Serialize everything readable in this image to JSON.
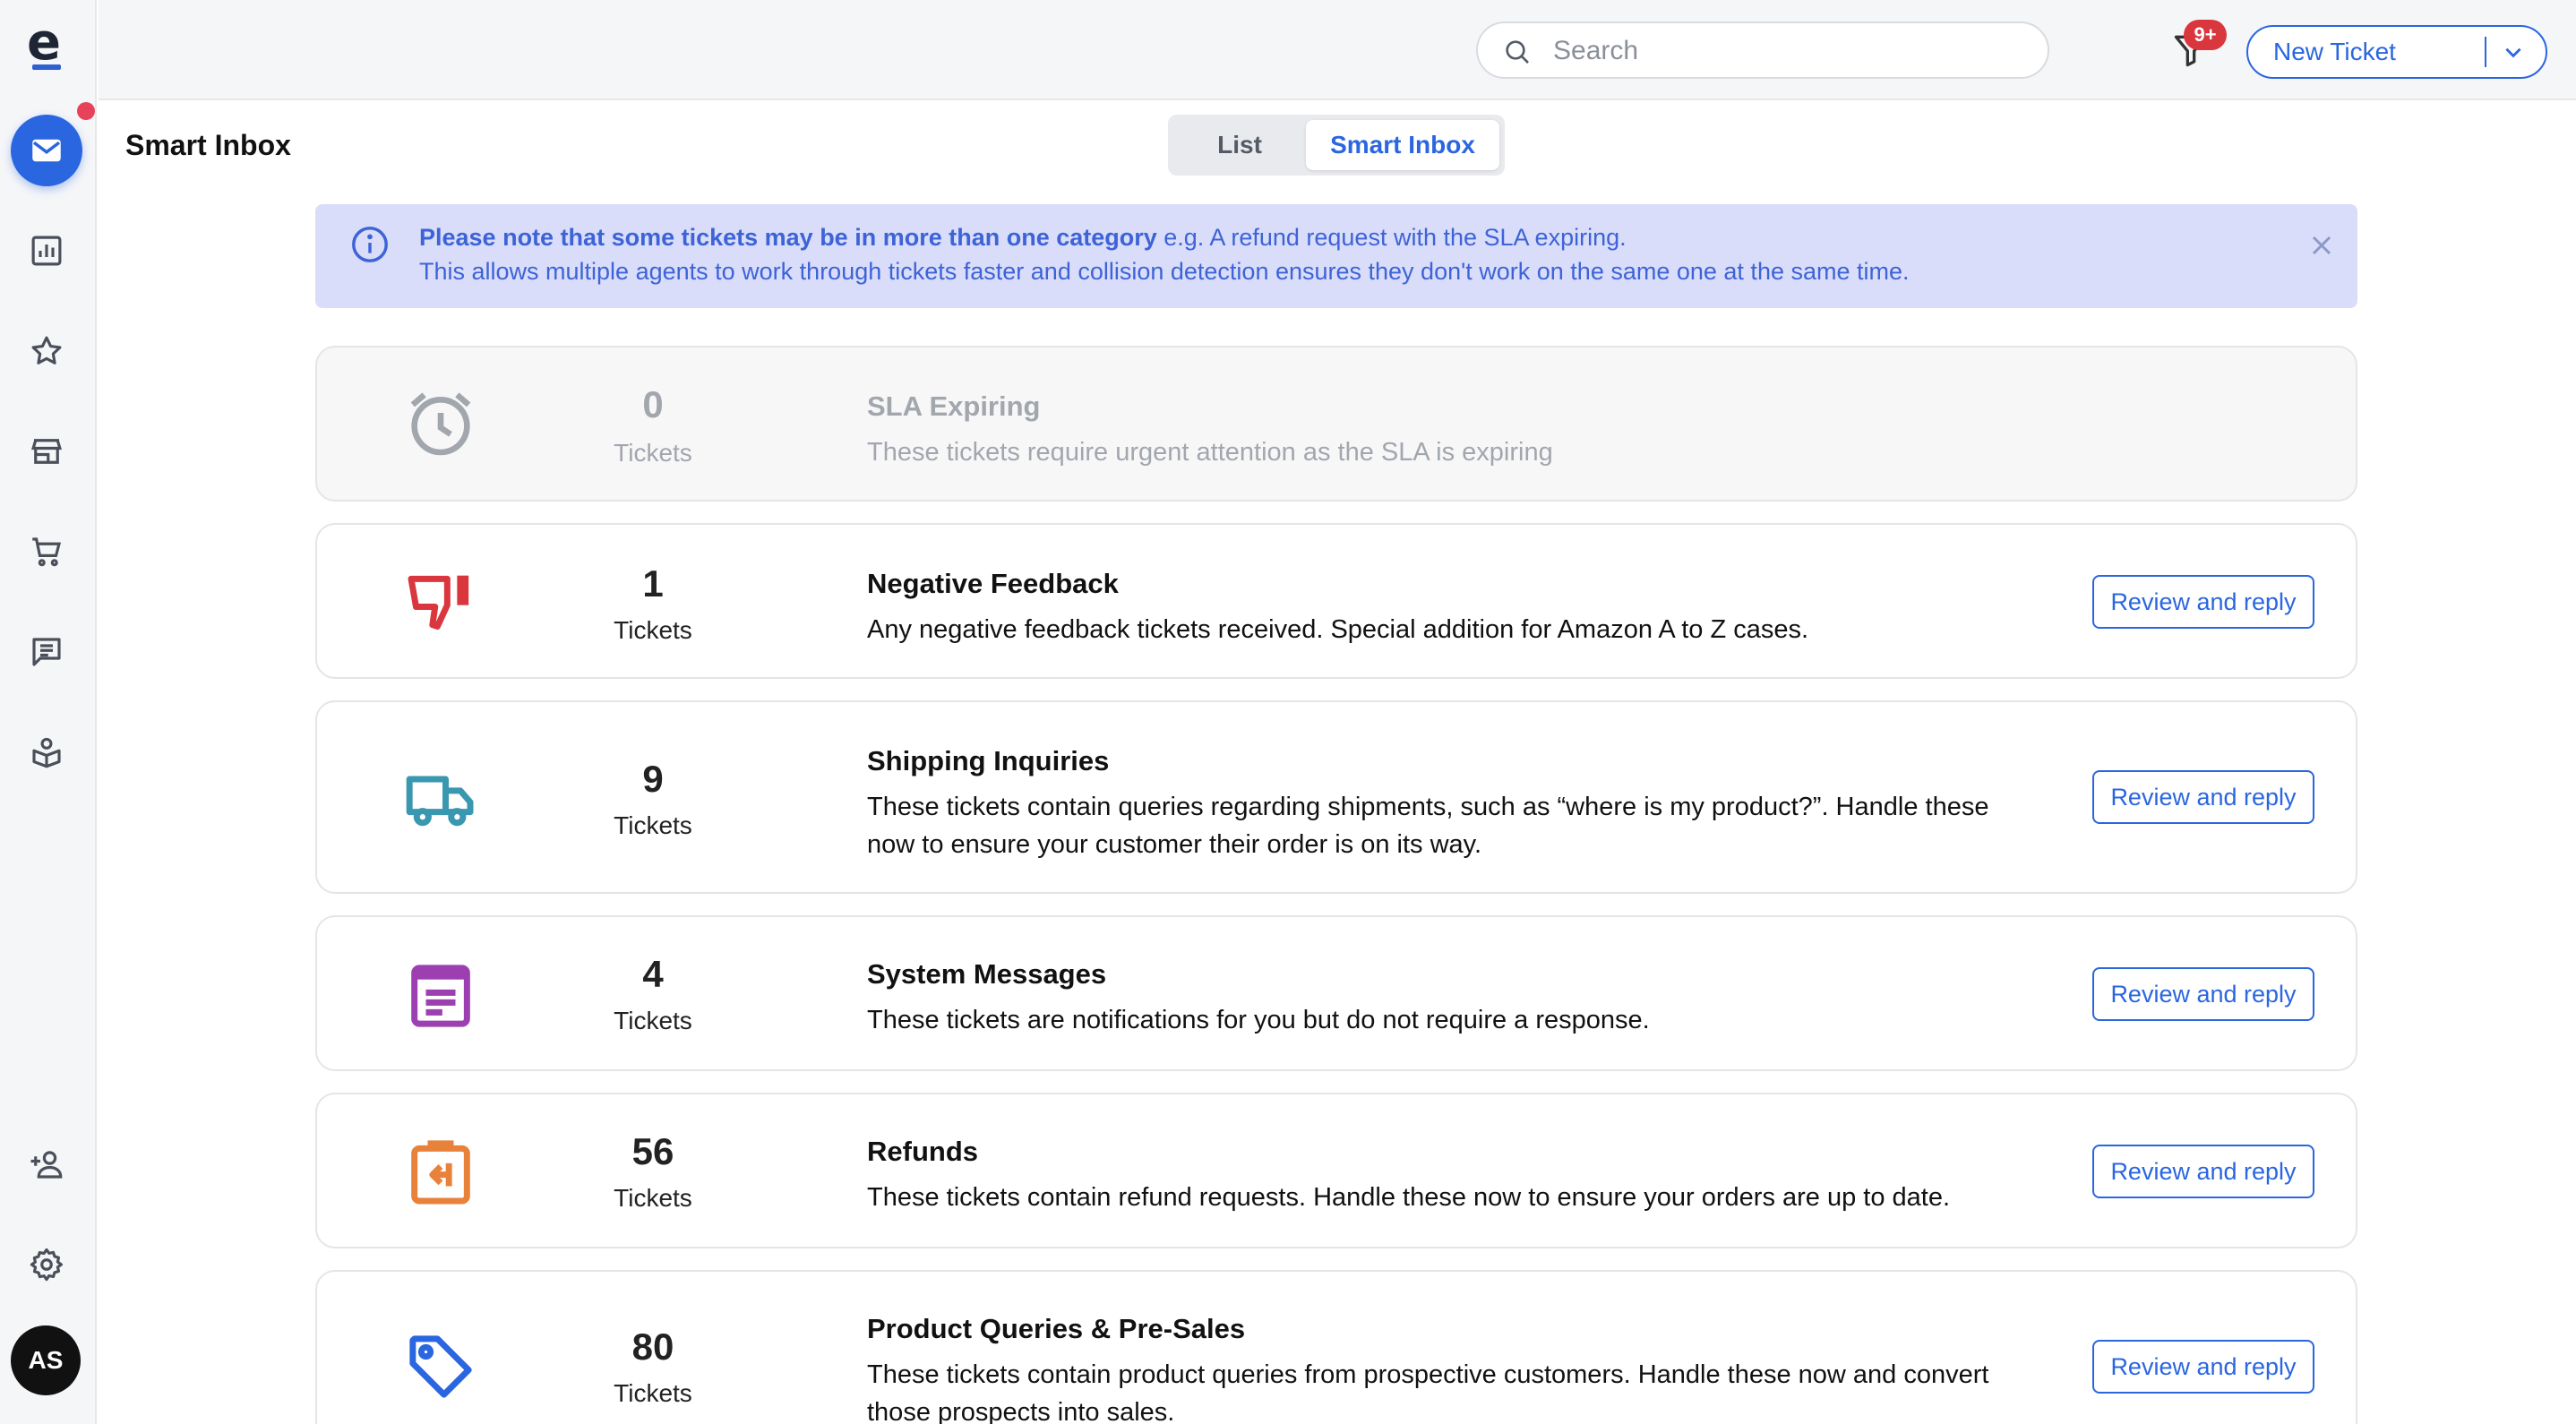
{
  "app": {
    "logo_letter": "e",
    "brand_color": "#2a66e0",
    "avatar_initials": "AS"
  },
  "sidebar": {
    "items": [
      {
        "icon": "mail-icon",
        "active": true
      },
      {
        "icon": "bar-chart-icon"
      },
      {
        "icon": "star-icon"
      },
      {
        "icon": "store-icon"
      },
      {
        "icon": "shopping-cart-icon"
      },
      {
        "icon": "chat-message-icon"
      },
      {
        "icon": "knowledge-base-icon"
      },
      {
        "icon": "add-user-icon"
      },
      {
        "icon": "gear-icon"
      }
    ]
  },
  "topbar": {
    "search_placeholder": "Search",
    "notifications_badge": "9+",
    "new_ticket_label": "New Ticket"
  },
  "header": {
    "title": "Smart Inbox",
    "tabs": [
      {
        "label": "List",
        "active": false
      },
      {
        "label": "Smart Inbox",
        "active": true
      }
    ]
  },
  "banner": {
    "bold_text": "Please note that some tickets may be in more than one category",
    "rest_text": " e.g. A refund request with the SLA expiring.",
    "line2": "This allows multiple agents to work through tickets faster and collision detection ensures they don't work on the same one at the same time."
  },
  "categories": [
    {
      "icon": "alarm-clock-icon",
      "count": "0",
      "unit": "Tickets",
      "title": "SLA Expiring",
      "description": "These tickets require urgent attention as the SLA is expiring",
      "muted": true,
      "color": "#a2a6ad"
    },
    {
      "icon": "thumbs-down-icon",
      "count": "1",
      "unit": "Tickets",
      "title": "Negative Feedback",
      "description": "Any negative feedback tickets received. Special addition for Amazon A to Z cases.",
      "action": "Review and reply",
      "color": "#d9363e"
    },
    {
      "icon": "delivery-truck-icon",
      "count": "9",
      "unit": "Tickets",
      "title": "Shipping Inquiries",
      "description": "These tickets contain queries regarding shipments, such as “where is my product?”. Handle these now to ensure your customer their order is on its way.",
      "action": "Review and reply",
      "color": "#3a97b0"
    },
    {
      "icon": "system-message-icon",
      "count": "4",
      "unit": "Tickets",
      "title": "System Messages",
      "description": "These tickets are notifications for you but do not require a response.",
      "action": "Review and reply",
      "color": "#9c3fb0"
    },
    {
      "icon": "refund-clipboard-icon",
      "count": "56",
      "unit": "Tickets",
      "title": "Refunds",
      "description": "These tickets contain refund requests. Handle these now to ensure your orders are up to date.",
      "action": "Review and reply",
      "color": "#e8823a"
    },
    {
      "icon": "price-tag-icon",
      "count": "80",
      "unit": "Tickets",
      "title": "Product Queries & Pre-Sales",
      "description": "These tickets contain product queries from prospective customers. Handle these now and convert those prospects into sales.",
      "action": "Review and reply",
      "color": "#2a66e0"
    }
  ]
}
